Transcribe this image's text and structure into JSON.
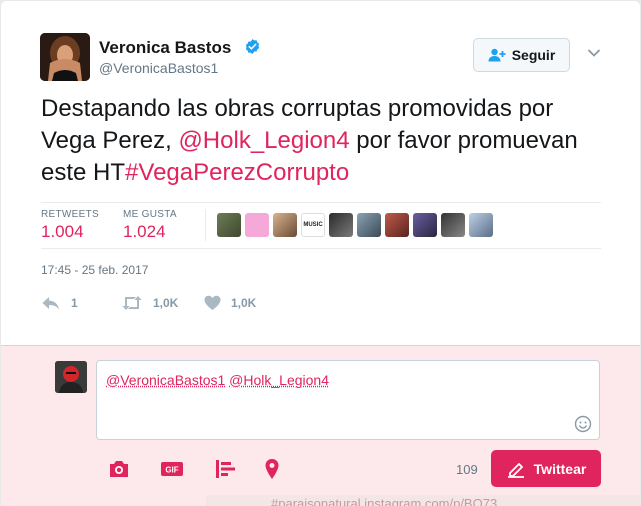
{
  "tweet": {
    "author_name": "Veronica Bastos",
    "author_handle": "@VeronicaBastos1",
    "follow_label": "Seguir",
    "text_part1": "Destapando las obras corruptas promovidas por Vega Perez, ",
    "mention": "@Holk_Legion4",
    "text_part2": " por favor promuevan este HT",
    "hashtag": "#VegaPerezCorrupto",
    "retweets_label": "RETWEETS",
    "retweets_count": "1.004",
    "likes_label": "ME GUSTA",
    "likes_count": "1.024",
    "liker_avatar_count": 10,
    "liker_music_text": "MUSIC",
    "timestamp": "17:45 - 25 feb. 2017",
    "actions": {
      "reply_count": "1",
      "retweet_count": "1,0K",
      "like_count": "1,0K"
    }
  },
  "reply": {
    "mention1": "@VeronicaBastos1",
    "mention2": "@Holk_Legion4",
    "char_counter": "109",
    "tweet_button_label": "Twittear",
    "tools": [
      "camera-icon",
      "gif-icon",
      "poll-icon",
      "location-icon"
    ]
  },
  "background": {
    "partial_text": "#paraisonatural instagram.com/p/BQ73..."
  },
  "colors": {
    "accent": "#e0245e",
    "verified": "#1da1f2",
    "muted": "#657786",
    "reply_bg": "#fde8ec"
  }
}
